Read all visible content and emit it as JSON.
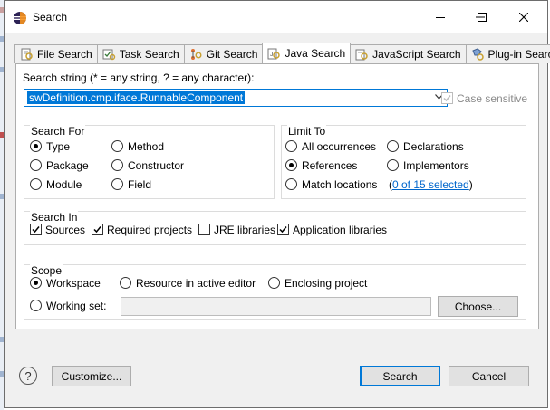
{
  "window": {
    "title": "Search",
    "minimize_glyph": "—",
    "maximize_glyph": "□",
    "close_glyph": "✕"
  },
  "tabs": [
    {
      "label": "File Search",
      "icon": "file-search-icon"
    },
    {
      "label": "Task Search",
      "icon": "task-search-icon"
    },
    {
      "label": "Git Search",
      "icon": "git-search-icon"
    },
    {
      "label": "Java Search",
      "icon": "java-search-icon",
      "active": true
    },
    {
      "label": "JavaScript Search",
      "icon": "javascript-search-icon"
    },
    {
      "label": "Plug-in Search",
      "icon": "plugin-search-icon"
    }
  ],
  "search_string": {
    "label": "Search string (* = any string, ? = any character):",
    "value": "swDefinition.cmp.iface.RunnableComponent",
    "case_sensitive_label": "Case sensitive",
    "case_sensitive": true
  },
  "search_for": {
    "title": "Search For",
    "options": [
      "Type",
      "Method",
      "Package",
      "Constructor",
      "Module",
      "Field"
    ],
    "selected": "Type"
  },
  "limit_to": {
    "title": "Limit To",
    "options": [
      "All occurrences",
      "Declarations",
      "References",
      "Implementors",
      "Match locations"
    ],
    "selected": "References",
    "link_open": "(",
    "link_text": "0 of 15 selected",
    "link_close": ")"
  },
  "search_in": {
    "title": "Search In",
    "items": [
      {
        "label": "Sources",
        "checked": true
      },
      {
        "label": "Required projects",
        "checked": true
      },
      {
        "label": "JRE libraries",
        "checked": false
      },
      {
        "label": "Application libraries",
        "checked": true
      }
    ]
  },
  "scope": {
    "title": "Scope",
    "options": [
      "Workspace",
      "Resource in active editor",
      "Enclosing project",
      "Working set:"
    ],
    "selected": "Workspace",
    "working_set_value": "",
    "choose_label": "Choose..."
  },
  "footer": {
    "help_glyph": "?",
    "customize_label": "Customize...",
    "search_label": "Search",
    "cancel_label": "Cancel"
  },
  "colors": {
    "accent": "#0078d7",
    "link": "#0066cc",
    "dialog_bg": "#f0f0f0"
  }
}
